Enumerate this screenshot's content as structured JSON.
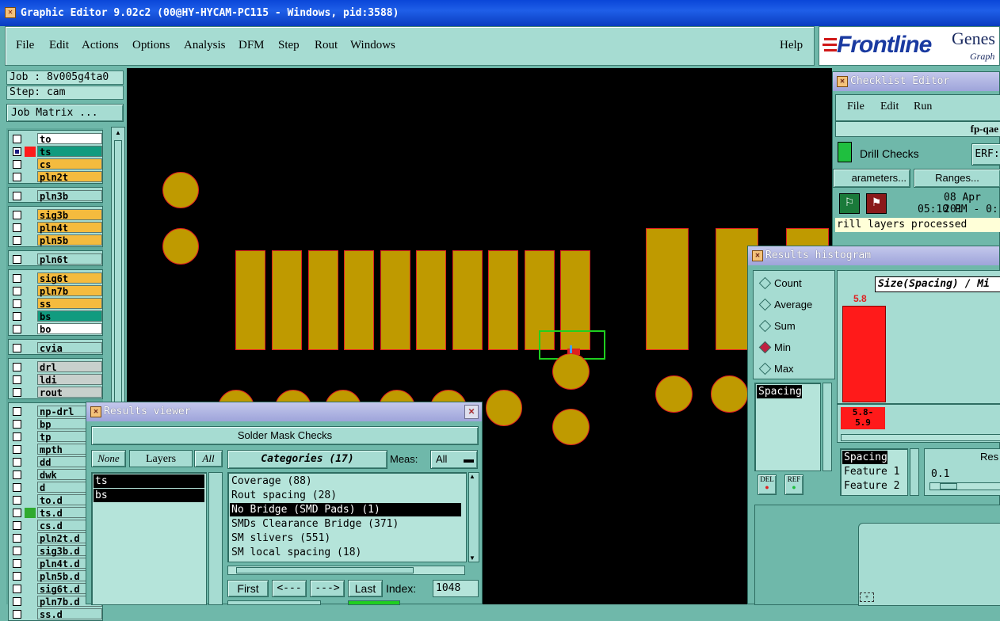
{
  "app": {
    "title": "Graphic Editor 9.02c2 (00@HY-HYCAM-PC115 - Windows, pid:3588)"
  },
  "menu": {
    "items": [
      "File",
      "Edit",
      "Actions",
      "Options",
      "Analysis",
      "DFM",
      "Step",
      "Rout",
      "Windows"
    ],
    "help": "Help"
  },
  "logo": {
    "brand": "Frontline",
    "partial": "Genes",
    "sub": "Graph"
  },
  "job": {
    "job": "Job : 8v005g4ta0",
    "step": "Step: cam",
    "matrix_button": "Job Matrix ..."
  },
  "layers": [
    {
      "name": "to",
      "color": "#ffffff"
    },
    {
      "name": "ts",
      "color": "#119b7f"
    },
    {
      "name": "cs",
      "color": "#f4bb3e"
    },
    {
      "name": "pln2t",
      "color": "#f4bb3e"
    },
    {
      "name": "pln3b",
      "color": "#a6dcd2"
    },
    {
      "name": "sig3b",
      "color": "#f4bb3e"
    },
    {
      "name": "pln4t",
      "color": "#f4bb3e"
    },
    {
      "name": "pln5b",
      "color": "#f4bb3e"
    },
    {
      "name": "pln6t",
      "color": "#a6dcd2"
    },
    {
      "name": "sig6t",
      "color": "#f4bb3e"
    },
    {
      "name": "pln7b",
      "color": "#f4bb3e"
    },
    {
      "name": "ss",
      "color": "#f4bb3e"
    },
    {
      "name": "bs",
      "color": "#119b7f"
    },
    {
      "name": "bo",
      "color": "#ffffff"
    },
    {
      "name": "cvia",
      "color": "#a6dcd2"
    },
    {
      "name": "drl",
      "color": "#c8d0cc"
    },
    {
      "name": "ldi",
      "color": "#c8d0cc"
    },
    {
      "name": "rout",
      "color": "#c8d0cc"
    },
    {
      "name": "np-drl",
      "color": "#a6dcd2"
    },
    {
      "name": "bp",
      "color": "#a6dcd2"
    },
    {
      "name": "tp",
      "color": "#a6dcd2"
    },
    {
      "name": "mpth",
      "color": "#a6dcd2"
    },
    {
      "name": "dd",
      "color": "#a6dcd2"
    },
    {
      "name": "dwk",
      "color": "#a6dcd2"
    },
    {
      "name": "d",
      "color": "#a6dcd2"
    },
    {
      "name": "to.d",
      "color": "#a6dcd2"
    },
    {
      "name": "ts.d",
      "color": "#a6dcd2"
    },
    {
      "name": "cs.d",
      "color": "#a6dcd2"
    },
    {
      "name": "pln2t.d",
      "color": "#a6dcd2"
    },
    {
      "name": "sig3b.d",
      "color": "#a6dcd2"
    },
    {
      "name": "pln4t.d",
      "color": "#a6dcd2"
    },
    {
      "name": "pln5b.d",
      "color": "#a6dcd2"
    },
    {
      "name": "sig6t.d",
      "color": "#a6dcd2"
    },
    {
      "name": "pln7b.d",
      "color": "#a6dcd2"
    },
    {
      "name": "ss.d",
      "color": "#a6dcd2"
    }
  ],
  "checklist": {
    "title": "Checklist Editor",
    "menu": [
      "File",
      "Edit",
      "Run"
    ],
    "name": "fp-qae",
    "check": "Drill Checks",
    "erf": "ERF:",
    "params": "arameters...",
    "ranges": "Ranges...",
    "date": "08 Apr 201",
    "time": "05:10 PM - 0:",
    "status": "rill layers processed"
  },
  "histogram": {
    "title": "Results histogram",
    "options": [
      "Count",
      "Average",
      "Sum",
      "Min",
      "Max"
    ],
    "selected_option": "Min",
    "measures": [
      "Spacing"
    ],
    "chart_title": "Size(Spacing) / Mi",
    "bar_value": "5.8",
    "bar_range": "5.8-\n5.9",
    "del": "DEL",
    "ref": "REF",
    "features": [
      "Spacing",
      "Feature 1",
      "Feature 2"
    ],
    "res_label": "Res",
    "res_value": "0.1"
  },
  "results_viewer": {
    "title": "Results viewer",
    "header": "Solder Mask Checks",
    "none": "None",
    "layers": "Layers",
    "all": "All",
    "layer_items": [
      "ts",
      "bs"
    ],
    "categories": "Categories (17)",
    "meas_label": "Meas:",
    "meas_value": "All",
    "category_items": [
      "Coverage (88)",
      "Rout spacing (28)",
      "No Bridge (SMD Pads) (1)",
      "SMDs Clearance Bridge (371)",
      "SM slivers (551)",
      "SM local spacing (18)"
    ],
    "selected_category": "No Bridge (SMD Pads) (1)",
    "nav": [
      "First",
      "<---",
      "--->",
      "Last"
    ],
    "index_label": "Index:",
    "index_value": "1048"
  },
  "colors": {
    "canvas": "#000000",
    "pad": "#bf9a00",
    "outline": "#e02020",
    "highlight": "#1fcf1f"
  }
}
